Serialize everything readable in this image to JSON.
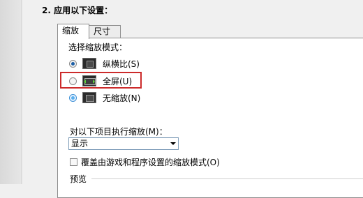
{
  "section": {
    "title": "2. 应用以下设置："
  },
  "tabs": [
    {
      "label": "缩放"
    },
    {
      "label": "尺寸"
    }
  ],
  "scaling_mode": {
    "label": "选择缩放模式：",
    "options": [
      {
        "label": "纵横比(S)",
        "icon": "aspect-ratio-icon",
        "selected": true
      },
      {
        "label": "全屏(U)",
        "icon": "full-screen-icon",
        "selected": false,
        "highlighted": true
      },
      {
        "label": "无缩放(N)",
        "icon": "no-scaling-icon",
        "selected": false
      }
    ]
  },
  "scaling_target": {
    "label": "对以下项目执行缩放(M)：",
    "selected_value": "显示"
  },
  "override": {
    "label": "覆盖由游戏和程序设置的缩放模式(O)",
    "checked": false
  },
  "preview": {
    "label": "预览"
  },
  "colors": {
    "highlight_border": "#cc2b2b",
    "radio_selected": "#1d5fa6"
  }
}
